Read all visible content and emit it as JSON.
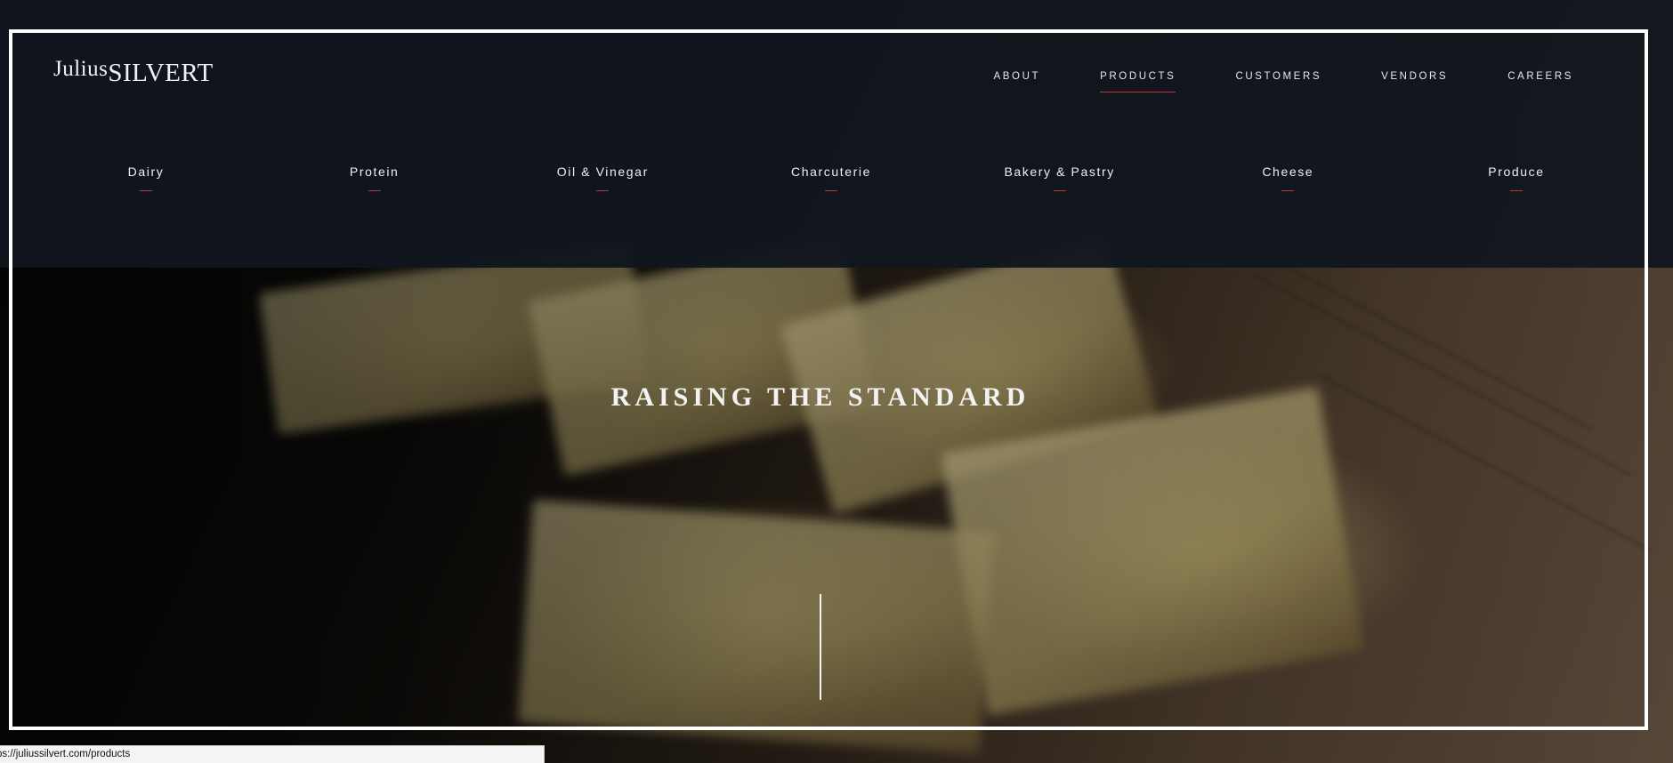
{
  "brand": {
    "logo_first": "Julius",
    "logo_last": "SILVERT"
  },
  "nav": {
    "items": [
      {
        "label": "ABOUT",
        "active": false
      },
      {
        "label": "PRODUCTS",
        "active": true
      },
      {
        "label": "CUSTOMERS",
        "active": false
      },
      {
        "label": "VENDORS",
        "active": false
      },
      {
        "label": "CAREERS",
        "active": false
      }
    ]
  },
  "products_menu": {
    "items": [
      {
        "label": "Dairy"
      },
      {
        "label": "Protein"
      },
      {
        "label": "Oil & Vinegar"
      },
      {
        "label": "Charcuterie"
      },
      {
        "label": "Bakery & Pastry"
      },
      {
        "label": "Cheese"
      },
      {
        "label": "Produce"
      }
    ]
  },
  "hero": {
    "title": "RAISING THE STANDARD"
  },
  "status_bar": {
    "url": "ps://juliussilvert.com/products"
  },
  "colors": {
    "header_background": "#11161e",
    "accent_red": "#c0323c",
    "frame": "#ffffff",
    "text_light": "#f0f0f0"
  }
}
